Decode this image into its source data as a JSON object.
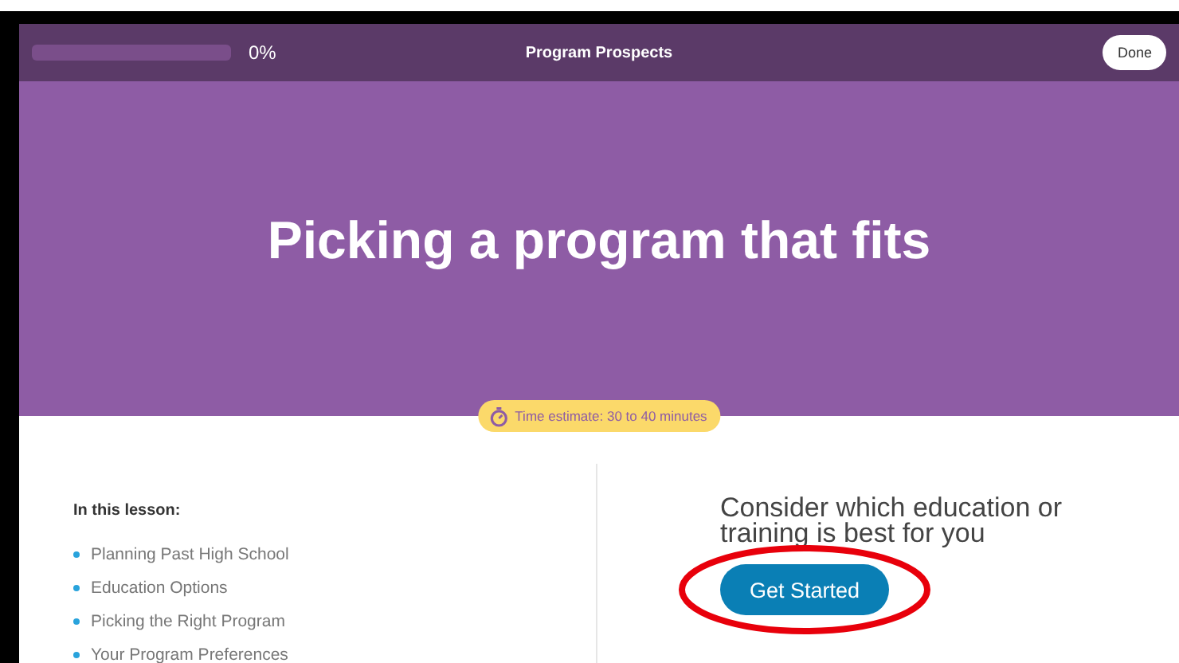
{
  "top_bar": {
    "progress": {
      "level": 0,
      "reading": "0%"
    },
    "title": "Program Prospects",
    "done_button": "Done"
  },
  "hero": {
    "title": "Picking a program that fits",
    "time_estimate": "Time estimate: 30 to 40 minutes"
  },
  "lesson": {
    "heading": "In this lesson:",
    "items": [
      "Planning Past High School",
      "Education Options",
      "Picking the Right Program",
      "Your Program Preferences"
    ]
  },
  "intro": {
    "text": "Consider which education or training is best for you",
    "button": "Get Started",
    "highlighted": true
  }
}
